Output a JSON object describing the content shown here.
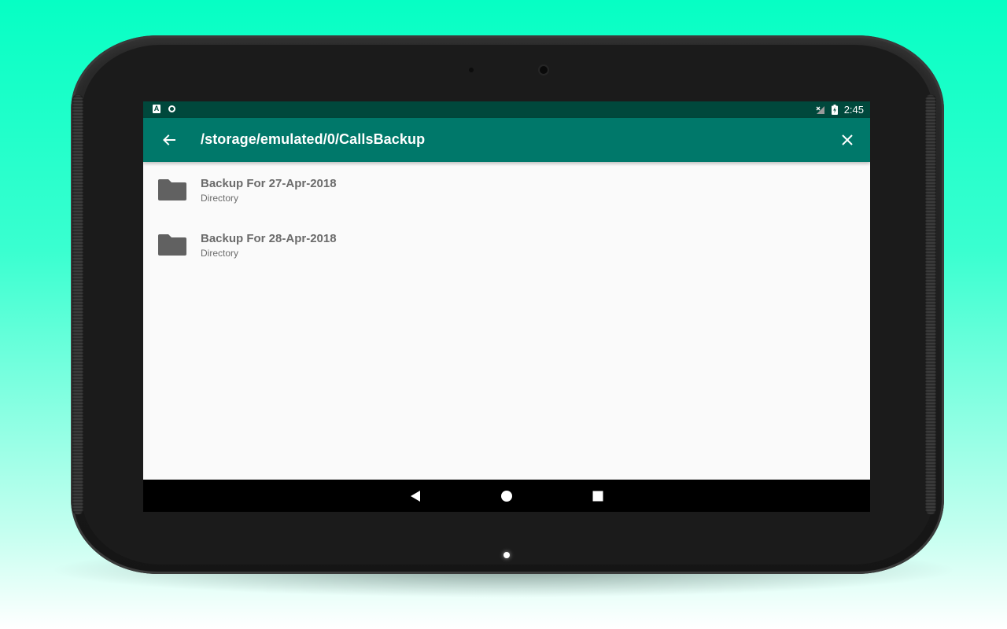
{
  "status_bar": {
    "time": "2:45",
    "left_icons": [
      "a-notification-icon",
      "sync-circle-icon"
    ],
    "right_icons": [
      "no-signal-icon",
      "battery-charging-icon"
    ],
    "a_glyph": "A"
  },
  "app_bar": {
    "title": "/storage/emulated/0/CallsBackup",
    "back_icon": "arrow-back-icon",
    "close_icon": "close-icon",
    "color": "#00786a",
    "status_color": "#00483c"
  },
  "files": [
    {
      "name": "Backup For 27-Apr-2018",
      "type": "Directory",
      "icon": "folder-icon"
    },
    {
      "name": "Backup For 28-Apr-2018",
      "type": "Directory",
      "icon": "folder-icon"
    }
  ],
  "nav_bar": {
    "buttons": [
      "back-triangle-icon",
      "home-circle-icon",
      "recents-square-icon"
    ]
  },
  "background_color": "#06ffc4"
}
